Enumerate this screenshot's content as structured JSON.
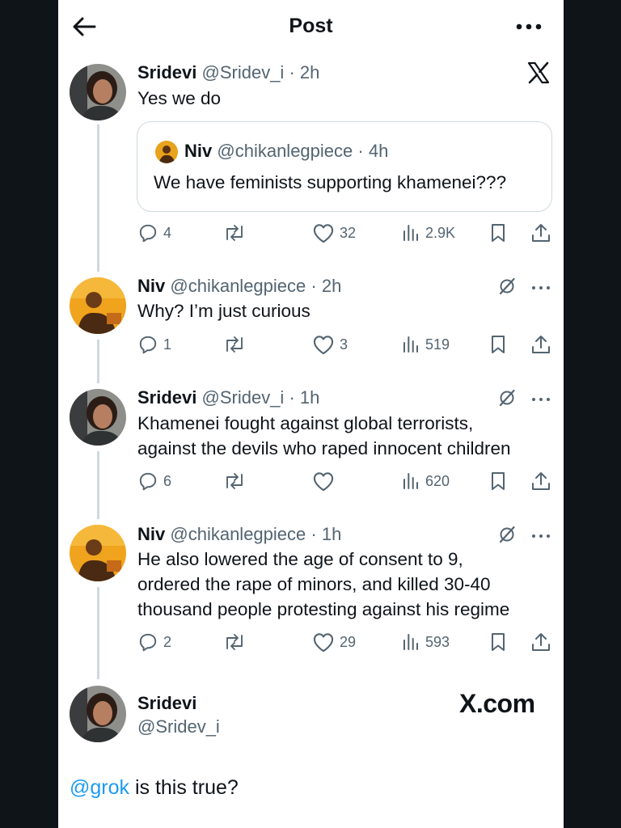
{
  "header": {
    "title": "Post"
  },
  "colors": {
    "accent": "#1d9bf0",
    "secondary_text": "#536471",
    "divider": "#cfd9de"
  },
  "posts": [
    {
      "name": "Sridevi",
      "handle": "@Sridev_i",
      "time": "2h",
      "text": "Yes we do",
      "quote": {
        "name": "Niv",
        "handle": "@chikanlegpiece",
        "time": "4h",
        "text": "We have feminists supporting khamenei???"
      },
      "stats": {
        "replies": "4",
        "reposts": "",
        "likes": "32",
        "views": "2.9K"
      }
    },
    {
      "name": "Niv",
      "handle": "@chikanlegpiece",
      "time": "2h",
      "text": "Why? I’m just curious",
      "stats": {
        "replies": "1",
        "reposts": "",
        "likes": "3",
        "views": "519"
      }
    },
    {
      "name": "Sridevi",
      "handle": "@Sridev_i",
      "time": "1h",
      "lines": [
        "Khamenei fought against global terrorists,",
        "against the devils who raped innocent children"
      ],
      "stats": {
        "replies": "6",
        "reposts": "",
        "likes": "",
        "views": "620"
      }
    },
    {
      "name": "Niv",
      "handle": "@chikanlegpiece",
      "time": "1h",
      "lines": [
        "He also lowered the age of consent to 9,",
        "ordered the rape of minors, and killed 30-40",
        "thousand people protesting against his regime"
      ],
      "stats": {
        "replies": "2",
        "reposts": "",
        "likes": "29",
        "views": "593"
      }
    }
  ],
  "main_post": {
    "name": "Sridevi",
    "handle": "@Sridev_i",
    "watermark": "X.com",
    "mention": "@grok",
    "text": " is this true?"
  },
  "icons": [
    "back-arrow-icon",
    "more-icon",
    "x-logo-icon",
    "grok-icon",
    "reply-icon",
    "repost-icon",
    "like-icon",
    "views-icon",
    "bookmark-icon",
    "share-icon"
  ]
}
